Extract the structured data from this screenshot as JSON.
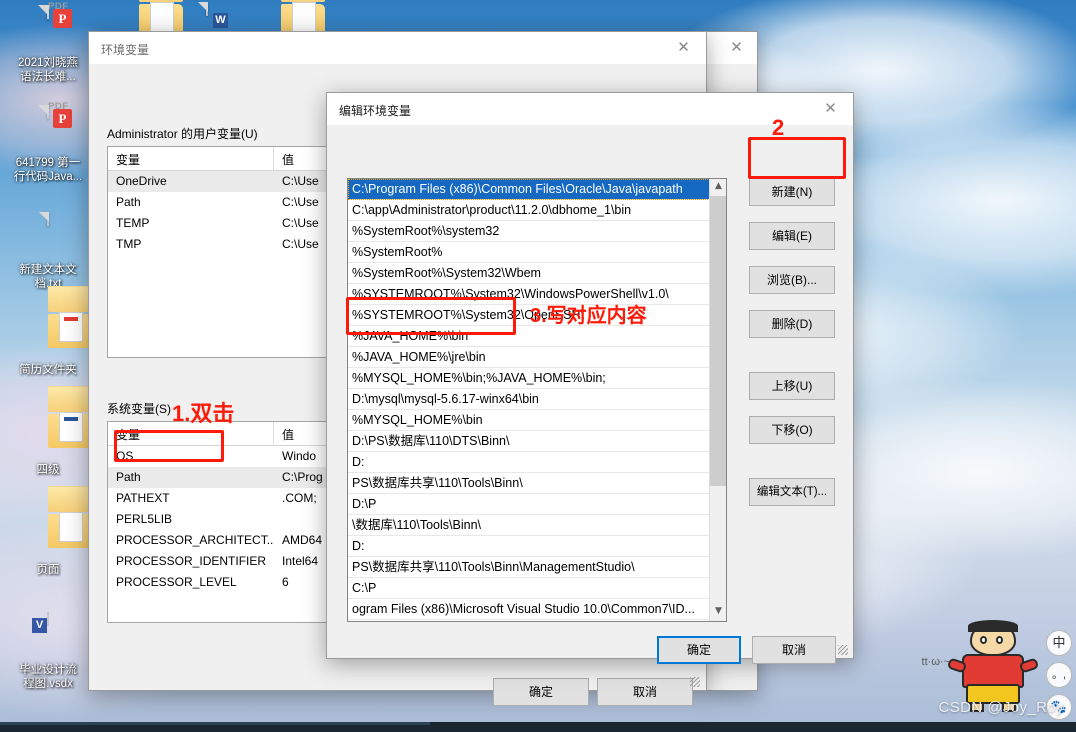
{
  "desktop": {
    "icons": [
      {
        "name": "2021刘晓燕\n语法长难...",
        "type": "pdf",
        "badge": "P",
        "sub": "PDF"
      },
      {
        "name": "641799 第一\n行代码Java...",
        "type": "pdf",
        "badge": "P",
        "sub": "PDF"
      },
      {
        "name": "新建文本文\n档.txt",
        "type": "txt"
      },
      {
        "name": "简历文件夹",
        "type": "folder"
      },
      {
        "name": "四级",
        "type": "folder"
      },
      {
        "name": "页面",
        "type": "folder"
      },
      {
        "name": "毕业设计流\n程图.vsdx",
        "type": "vsdx",
        "badge": "V"
      }
    ]
  },
  "env_window": {
    "title": "环境变量",
    "close_icon": "close-icon",
    "user_group_label": "Administrator 的用户变量(U)",
    "system_group_label": "系统变量(S)",
    "columns": [
      "变量",
      "值"
    ],
    "user_vars": [
      {
        "name": "OneDrive",
        "value": "C:\\Use"
      },
      {
        "name": "Path",
        "value": "C:\\Use"
      },
      {
        "name": "TEMP",
        "value": "C:\\Use"
      },
      {
        "name": "TMP",
        "value": "C:\\Use"
      }
    ],
    "system_vars": [
      {
        "name": "OS",
        "value": "Windo"
      },
      {
        "name": "Path",
        "value": "C:\\Prog"
      },
      {
        "name": "PATHEXT",
        "value": ".COM;"
      },
      {
        "name": "PERL5LIB",
        "value": ""
      },
      {
        "name": "PROCESSOR_ARCHITECT...",
        "value": "AMD64"
      },
      {
        "name": "PROCESSOR_IDENTIFIER",
        "value": "Intel64"
      },
      {
        "name": "PROCESSOR_LEVEL",
        "value": "6"
      }
    ],
    "ok_label": "确定",
    "cancel_label": "取消"
  },
  "edit_dialog": {
    "title": "编辑环境变量",
    "close_icon": "close-icon",
    "paths": [
      "C:\\Program Files (x86)\\Common Files\\Oracle\\Java\\javapath",
      "C:\\app\\Administrator\\product\\11.2.0\\dbhome_1\\bin",
      "%SystemRoot%\\system32",
      "%SystemRoot%",
      "%SystemRoot%\\System32\\Wbem",
      "%SYSTEMROOT%\\System32\\WindowsPowerShell\\v1.0\\",
      "%SYSTEMROOT%\\System32\\OpenSSH\\",
      "%JAVA_HOME%\\bin",
      "%JAVA_HOME%\\jre\\bin",
      "%MYSQL_HOME%\\bin;%JAVA_HOME%\\bin;",
      "D:\\mysql\\mysql-5.6.17-winx64\\bin",
      "%MYSQL_HOME%\\bin",
      "D:\\PS\\数据库\\110\\DTS\\Binn\\",
      "D:",
      "PS\\数据库共享\\110\\Tools\\Binn\\",
      "D:\\P",
      "\\数据库\\110\\Tools\\Binn\\",
      "D:",
      "PS\\数据库共享\\110\\Tools\\Binn\\ManagementStudio\\",
      "C:\\P",
      "ogram Files (x86)\\Microsoft Visual Studio 10.0\\Common7\\ID..."
    ],
    "selected_index": 0,
    "side_buttons": [
      {
        "label": "新建(N)",
        "accel": "N"
      },
      {
        "label": "编辑(E)",
        "accel": "E"
      },
      {
        "label": "浏览(B)...",
        "accel": "B"
      },
      {
        "label": "删除(D)",
        "accel": "D"
      },
      {
        "label": "上移(U)",
        "accel": "U"
      },
      {
        "label": "下移(O)",
        "accel": "O"
      },
      {
        "label": "编辑文本(T)...",
        "accel": "T"
      }
    ],
    "ok_label": "确定",
    "cancel_label": "取消",
    "scrollbar": {
      "up_icon": "chevron-up-icon",
      "down_icon": "chevron-down-icon"
    }
  },
  "annotations": {
    "color": "#fd1a08",
    "step1": "1.双击",
    "step2": "2",
    "step3": "3.写对应内容"
  },
  "watermark": {
    "text": "CSDN @Joy_Roy"
  },
  "ime": {
    "mode": "中",
    "punct": "。,",
    "extra": "ime-icon"
  },
  "sticker": {
    "caption": "tt·ω·~"
  }
}
